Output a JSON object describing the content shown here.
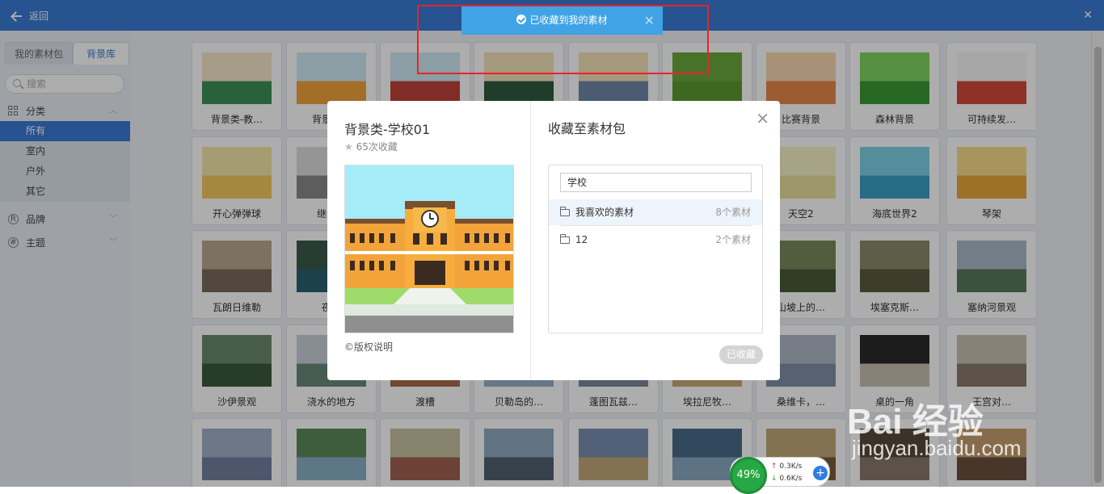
{
  "topbar": {
    "back_label": "返回"
  },
  "sidebar": {
    "tabs": [
      "我的素材包",
      "背景库"
    ],
    "search_placeholder": "搜索",
    "group_category": "分类",
    "items": [
      "所有",
      "室内",
      "户外",
      "其它"
    ],
    "group_brand": "品牌",
    "group_theme": "主题"
  },
  "grid": {
    "labels": [
      "背景类-教…",
      "背景类…",
      "",
      "",
      "",
      "",
      "比赛背景",
      "森林背景",
      "可持续发…",
      "开心弹弹球",
      "继续…",
      "",
      "",
      "",
      "",
      "天空2",
      "海底世界2",
      "琴架",
      "瓦朗日维勒",
      "夜…",
      "",
      "",
      "",
      "",
      "山坡上的…",
      "埃塞克斯…",
      "塞纳河景观",
      "沙伊景观",
      "浇水的地方",
      "渡槽",
      "贝勒岛的…",
      "蓬图瓦兹…",
      "埃拉尼牧…",
      "桑维卡，…",
      "桌的一角",
      "王宫对…"
    ]
  },
  "toast": {
    "text": "已收藏到我的素材"
  },
  "dialog": {
    "title": "背景类-学校01",
    "fav_count": "65次收藏",
    "copyright": "©版权说明",
    "right_title": "收藏至素材包",
    "input_value": "学校",
    "packages": [
      {
        "name": "我喜欢的素材",
        "count": "8个素材"
      },
      {
        "name": "12",
        "count": "2个素材"
      }
    ],
    "button": "已收藏"
  },
  "net": {
    "percent": "49%",
    "up": "0.3K/s",
    "down": "0.6K/s"
  },
  "watermark": {
    "main": "Bai 经验",
    "sub": "jingyan.baidu.com"
  },
  "colors": {
    "accent": "#3a7bd5",
    "toast": "#3fa3e6",
    "highlight": "#e8242a"
  }
}
